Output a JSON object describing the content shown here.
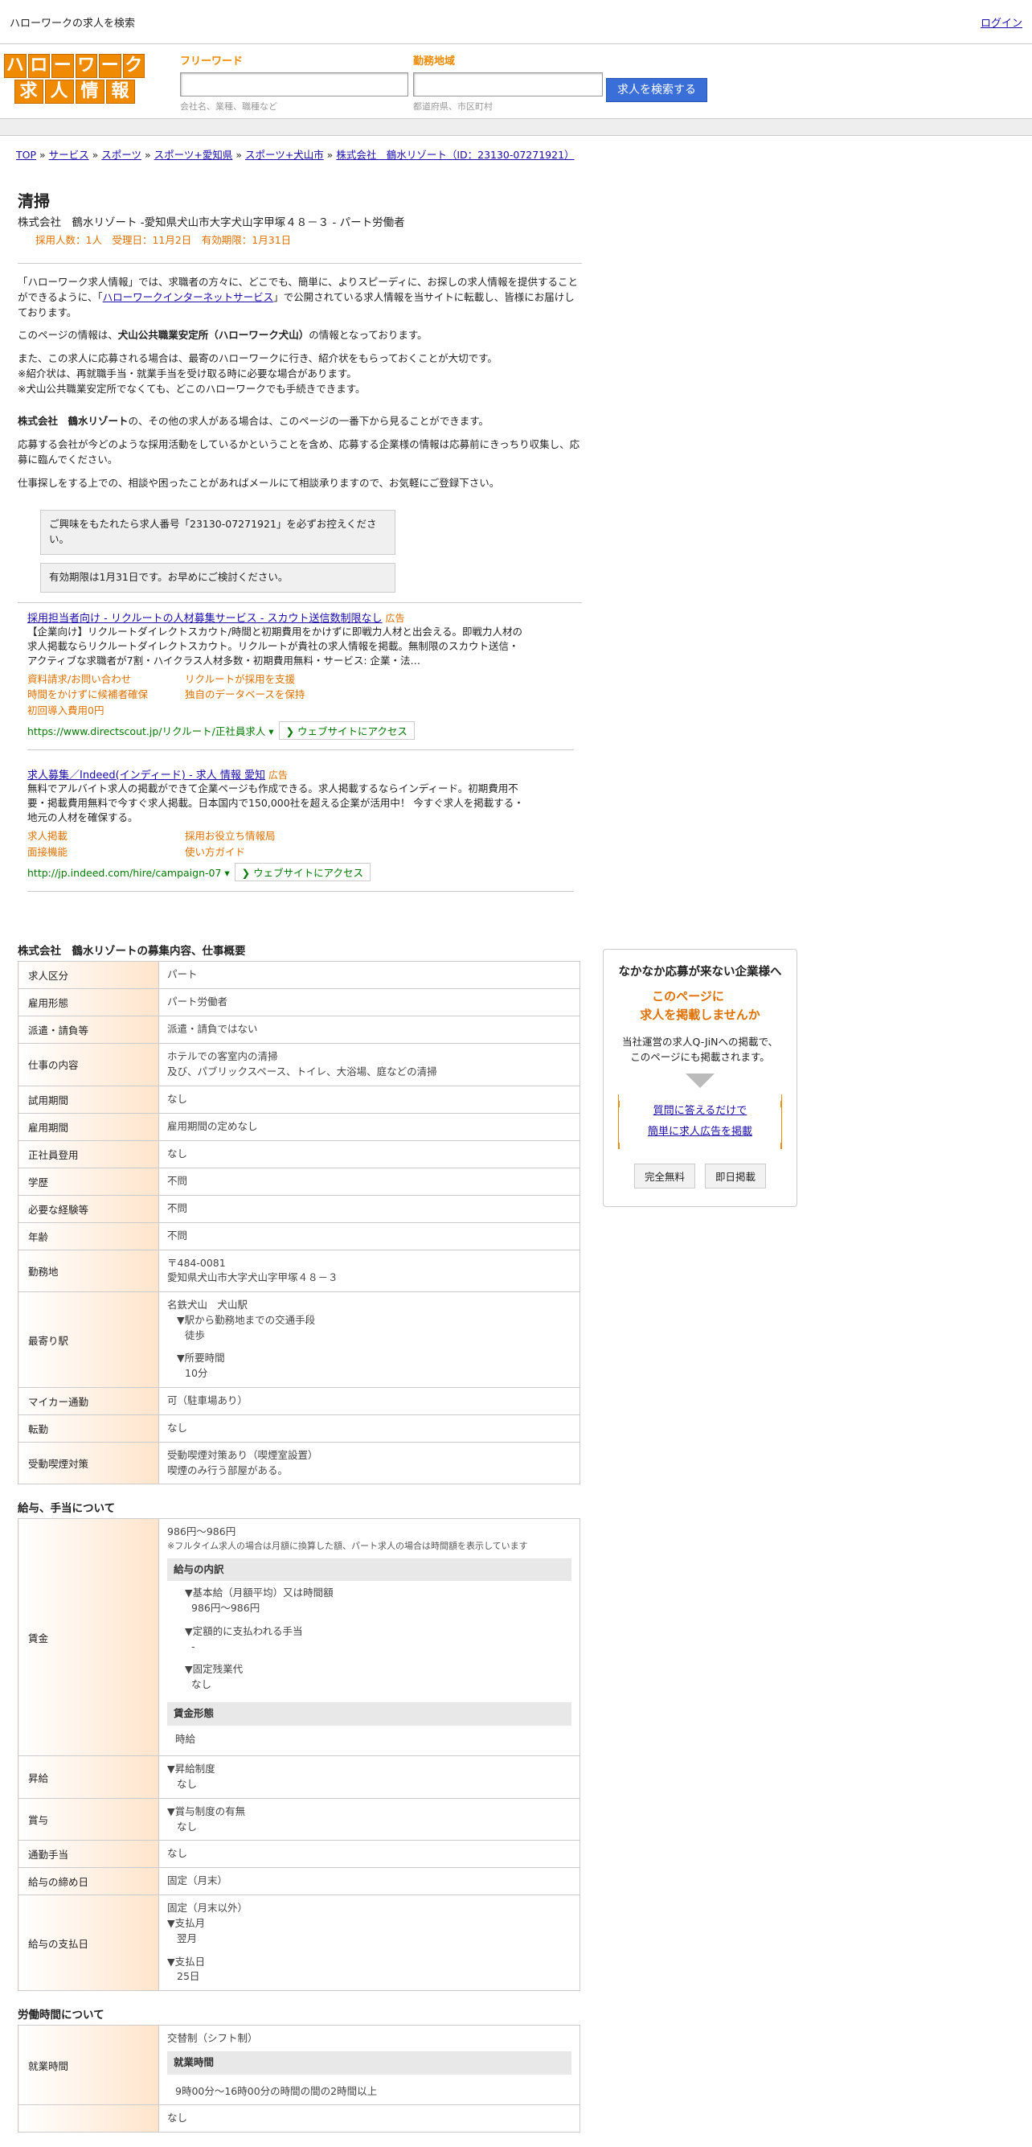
{
  "topbar": {
    "title": "ハローワークの求人を検索",
    "login": "ログイン"
  },
  "logo": {
    "row1": [
      "ハ",
      "ロ",
      "ー",
      "ワ",
      "ー",
      "ク"
    ],
    "row2": [
      "求",
      "人",
      "情",
      "報"
    ]
  },
  "search": {
    "freeword_label": "フリーワード",
    "freeword_placeholder": "会社名、業種、職種など",
    "area_label": "勤務地域",
    "area_placeholder": "都道府県、市区町村",
    "button": "求人を検索する"
  },
  "breadcrumb": [
    "TOP",
    "サービス",
    "スポーツ",
    "スポーツ+愛知県",
    "スポーツ+犬山市",
    "株式会社　鶴水リゾート（ID：23130-07271921）"
  ],
  "job": {
    "title": "清掃",
    "subtitle": "株式会社　鶴水リゾート -愛知県犬山市大字犬山字甲塚４８－３ - パート労働者",
    "meta": "採用人数：1人　受理日：11月2日　有効期限：1月31日"
  },
  "intro": {
    "p1a": "「ハローワーク求人情報」では、求職者の方々に、どこでも、簡単に、よりスピーディに、お探しの求人情報を提供することができるように、「",
    "p1link": "ハローワークインターネットサービス",
    "p1b": "」で公開されている求人情報を当サイトに転載し、皆様にお届けしております。",
    "p2a": "このページの情報は、",
    "p2b": "犬山公共職業安定所（ハローワーク犬山）",
    "p2c": "の情報となっております。",
    "p3": [
      "また、この求人に応募される場合は、最寄のハローワークに行き、紹介状をもらっておくことが大切です。",
      "※紹介状は、再就職手当・就業手当を受け取る時に必要な場合があります。",
      "※犬山公共職業安定所でなくても、どこのハローワークでも手続きできます。"
    ],
    "p4a": "株式会社　鶴水リゾート",
    "p4b": "の、その他の求人がある場合は、このページの一番下から見ることができます。",
    "p5": "応募する会社が今どのような採用活動をしているかということを含め、応募する企業様の情報は応募前にきっちり収集し、応募に臨んでください。",
    "p6": "仕事探しをする上での、相談や困ったことがあればメールにて相談承りますので、お気軽にご登録下さい。"
  },
  "notices": [
    "ご興味をもたれたら求人番号「23130-07271921」を必ずお控えください。",
    "有効期限は1月31日です。お早めにご検討ください。"
  ],
  "ads": [
    {
      "title": "採用担当者向け - リクルートの人材募集サービス - スカウト送信数制限なし",
      "tag": "広告",
      "desc": "【企業向け】リクルートダイレクトスカウト/時間と初期費用をかけずに即戦力人材と出会える。即戦力人材の求人掲載ならリクルートダイレクトスカウト。リクルートが貴社の求人情報を掲載。無制限のスカウト送信・アクティブな求職者が7割・ハイクラス人材多数・初期費用無料・サービス: 企業・法…",
      "links": [
        "資料請求/お問い合わせ",
        "リクルートが採用を支援",
        "時間をかけずに候補者確保",
        "独自のデータベースを保持",
        "初回導入費用0円"
      ],
      "url": "https://www.directscout.jp/リクルート/正社員求人 ▾",
      "visit": "❯ ウェブサイトにアクセス"
    },
    {
      "title": "求人募集／Indeed(インディード) - 求人 情報 愛知",
      "tag": "広告",
      "desc": "無料でアルバイト求人の掲載ができて企業ページも作成できる。求人掲載するならインディード。初期費用不要・掲載費用無料で今すぐ求人掲載。日本国内で150,000社を超える企業が活用中！ 今すぐ求人を掲載する・地元の人材を確保する。",
      "links": [
        "求人掲載",
        "採用お役立ち情報局",
        "面接機能",
        "使い方ガイド"
      ],
      "url": "http://jp.indeed.com/hire/campaign-07 ▾",
      "visit": "❯ ウェブサイトにアクセス"
    }
  ],
  "sec1": {
    "title": "株式会社　鶴水リゾートの募集内容、仕事概要",
    "rows": [
      [
        "求人区分",
        "パート"
      ],
      [
        "雇用形態",
        "パート労働者"
      ],
      [
        "派遣・請負等",
        "派遣・請負ではない"
      ],
      [
        "仕事の内容",
        "ホテルでの客室内の清掃\n及び、パブリックスペース、トイレ、大浴場、庭などの清掃"
      ],
      [
        "試用期間",
        "なし"
      ],
      [
        "雇用期間",
        "雇用期間の定めなし"
      ],
      [
        "正社員登用",
        "なし"
      ],
      [
        "学歴",
        "不問"
      ],
      [
        "必要な経験等",
        "不問"
      ],
      [
        "年齢",
        "不問"
      ],
      [
        "勤務地",
        "〒484-0081\n愛知県犬山市大字犬山字甲塚４８－３"
      ]
    ],
    "station": {
      "label": "最寄り駅",
      "name": "名鉄犬山　犬山駅",
      "h1": "▼駅から勤務地までの交通手段",
      "v1": "徒歩",
      "h2": "▼所要時間",
      "v2": "10分"
    },
    "rows2": [
      [
        "マイカー通勤",
        "可（駐車場あり）"
      ],
      [
        "転勤",
        "なし"
      ],
      [
        "受動喫煙対策",
        "受動喫煙対策あり（喫煙室設置）\n喫煙のみ行う部屋がある。"
      ]
    ]
  },
  "sec2": {
    "title": "給与、手当について",
    "wage": {
      "label": "賃金",
      "value": "986円〜986円",
      "note": "※フルタイム求人の場合は月額に換算した額、パート求人の場合は時間額を表示しています",
      "breakdown": "給与の内訳",
      "b1h": "▼基本給（月額平均）又は時間額",
      "b1v": "986円〜986円",
      "b2h": "▼定額的に支払われる手当",
      "b2v": "-",
      "b3h": "▼固定残業代",
      "b3v": "なし",
      "form": "賃金形態",
      "formv": "時給"
    },
    "raise": {
      "label": "昇給",
      "h": "▼昇給制度",
      "v": "なし"
    },
    "bonus": {
      "label": "賞与",
      "h": "▼賞与制度の有無",
      "v": "なし"
    },
    "rows": [
      [
        "通勤手当",
        "なし"
      ],
      [
        "給与の締め日",
        "固定（月末）"
      ]
    ],
    "pay": {
      "label": "給与の支払日",
      "v": "固定（月末以外）",
      "h1": "▼支払月",
      "v1": "翌月",
      "h2": "▼支払日",
      "v2": "25日"
    }
  },
  "sec3": {
    "title": "労働時間について",
    "hours": {
      "label": "就業時間",
      "v": "交替制（シフト制）",
      "sub": "就業時間",
      "time": "9時00分〜16時00分の時間の間の2時間以上"
    },
    "next": "なし"
  },
  "side": {
    "heading": "なかなか応募が来ない企業様へ",
    "big1": "このページに",
    "big2": "求人を掲載しませんか",
    "txt1": "当社運営の求人Q-JiNへの掲載で、",
    "txt2": "このページにも掲載されます。",
    "link1": "質問に答えるだけで",
    "link2": "簡単に求人広告を掲載",
    "btn1": "完全無料",
    "btn2": "即日掲載"
  }
}
